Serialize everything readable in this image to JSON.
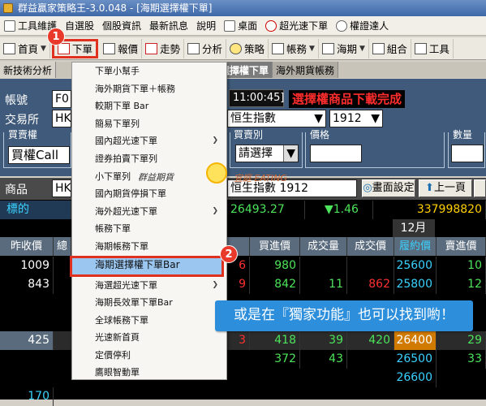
{
  "window": {
    "title": "群益贏家策略王-3.0.048 - [海期選擇權下單]"
  },
  "menu": [
    "工具維護",
    "自選股",
    "個股資訊",
    "最新訊息",
    "說明",
    "桌面",
    "超光速下單",
    "權證達人"
  ],
  "toolbar": [
    {
      "label": "首頁",
      "caret": "▼"
    },
    {
      "label": "下單"
    },
    {
      "label": "報價"
    },
    {
      "label": "走勢"
    },
    {
      "label": "分析"
    },
    {
      "label": "策略"
    },
    {
      "label": "帳務",
      "caret": "▼"
    },
    {
      "label": "海期",
      "caret": "▼"
    },
    {
      "label": "組合"
    },
    {
      "label": "工具"
    }
  ],
  "tabs": [
    "新技術分析",
    "期選擇權下單",
    "海外期貨帳務"
  ],
  "order_panel": {
    "account_label": "帳號",
    "account_value": "F0",
    "exchange_label": "交易所",
    "exchange_value": "HK",
    "time_value": "11:00:45]",
    "status_message": "選擇權商品下載完成",
    "index_name": "恒生指數",
    "month_value": "1912",
    "buysell_label": "買賣權",
    "buysell_value": "買權Call",
    "buysell_tab": "買賣別",
    "buysell_select": "請選擇",
    "price_label": "價格",
    "qty_label": "數量"
  },
  "quote_header": {
    "product_label": "商品",
    "product_value": "HK",
    "product_full": "恒生指數 1912",
    "screen_settings": "畫面設定",
    "prev_page": "上一頁",
    "target_label": "標的",
    "target_price": "26493.27",
    "target_change": "▼1.46",
    "target_volume": "337998820",
    "month": "12月"
  },
  "columns": [
    "昨收價",
    "總",
    "",
    "",
    "",
    "買進價",
    "成交量",
    "成交價",
    "履約價",
    "賣進價"
  ],
  "rows": [
    {
      "prev": "1009",
      "col6": "6",
      "bid": "980",
      "vol": "",
      "last": "",
      "strike": "25600",
      "ask": "10"
    },
    {
      "prev": "843",
      "col6": "9",
      "bid": "842",
      "vol": "11",
      "last": "862",
      "strike": "25800",
      "ask": "12"
    },
    {
      "prev": "",
      "col6": "",
      "bid": "",
      "vol": "",
      "last": "",
      "strike": "",
      "ask": ""
    },
    {
      "prev": "",
      "col6": "",
      "bid": "",
      "vol": "",
      "last": "",
      "strike": "",
      "ask": ""
    },
    {
      "prev": "425",
      "col6": "3",
      "bid": "418",
      "vol": "39",
      "last": "420",
      "strike": "26400",
      "ask": "29"
    },
    {
      "prev": "",
      "col6": "",
      "bid": "372",
      "vol": "43",
      "last": "",
      "strike": "26500",
      "ask": "33"
    },
    {
      "prev": "",
      "col6": "",
      "bid": "",
      "vol": "",
      "last": "",
      "strike": "26600",
      "ask": ""
    },
    {
      "prev": "170",
      "col6": "",
      "bid": "",
      "vol": "",
      "last": "",
      "strike": "",
      "ask": ""
    }
  ],
  "dropdown": [
    {
      "label": "下單小幫手"
    },
    {
      "label": "海外期貨下單＋帳務"
    },
    {
      "label": "較期下單 Bar"
    },
    {
      "label": "簡易下單列"
    },
    {
      "label": "國內超光速下單",
      "sub": true
    },
    {
      "label": "證券拍賣下單列"
    },
    {
      "label": "小下單列"
    },
    {
      "label": "國內期貨停損下單"
    },
    {
      "label": "海外超光速下單",
      "sub": true
    },
    {
      "label": "帳務下單"
    },
    {
      "label": "海期帳務下單"
    },
    {
      "label": "海期選擇權下單Bar",
      "highlight": true
    },
    {
      "label": "海選超光速下單",
      "sub": true
    },
    {
      "label": "海期長效單下單Bar"
    },
    {
      "label": "全球帳務下單"
    },
    {
      "label": "光速新首頁"
    },
    {
      "label": "定價停利"
    },
    {
      "label": "鷹眼智動單"
    }
  ],
  "badges": [
    "1",
    "2"
  ],
  "callout": "或是在『獨家功能』也可以找到喲！",
  "watermark": {
    "left": "群益期貨",
    "right": "宜庭 EATING"
  },
  "colors": {
    "callout": "#2d8fdc",
    "highlight": "#9ac6f0",
    "badge": "#e8392a",
    "panel": "#3f5a7a"
  }
}
